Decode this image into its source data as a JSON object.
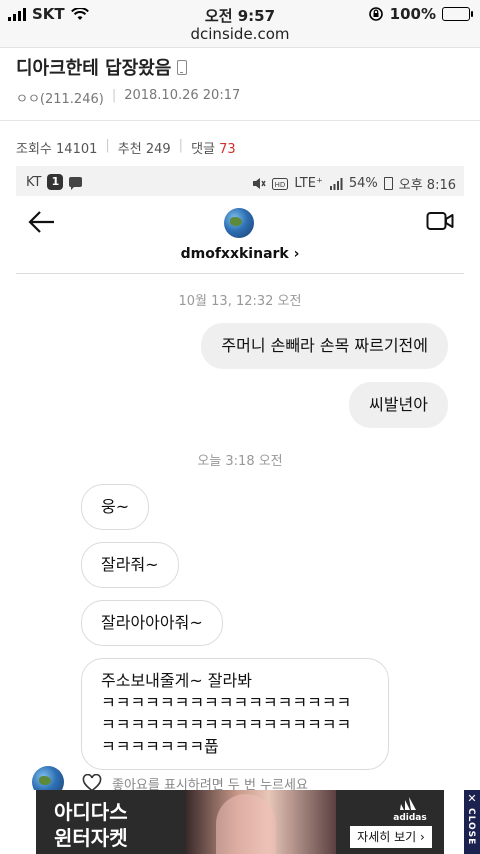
{
  "status_bar": {
    "carrier": "SKT",
    "time": "오전 9:57",
    "battery": "100%"
  },
  "browser": {
    "url": "dcinside.com"
  },
  "post": {
    "title": "디아크한테 답장왔음",
    "author": "ㅇㅇ(211.246)",
    "datetime": "2018.10.26 20:17",
    "views_label": "조회수",
    "views": "14101",
    "likes_label": "추천",
    "likes": "249",
    "comments_label": "댓글",
    "comments": "73"
  },
  "screenshot": {
    "android_status": {
      "carrier": "KT",
      "notification_count": "1",
      "network": "LTE⁺",
      "battery": "54%",
      "time": "오후 8:16"
    },
    "dm_header": {
      "username": "dmofxxkinark",
      "chevron": "›"
    },
    "messages": {
      "ts1": "10월 13, 12:32 오전",
      "out1": "주머니 손빼라 손목 짜르기전에",
      "out2": "씨발년아",
      "ts2": "오늘 3:18 오전",
      "in1": "웅~",
      "in2": "잘라줘~",
      "in3": "잘라아아아줘~",
      "in4_line1": "주소보내줄게~ 잘라봐",
      "in4_line2": "ㅋㅋㅋㅋㅋㅋㅋㅋㅋㅋㅋㅋㅋㅋㅋㅋㅋ",
      "in4_line3": "ㅋㅋㅋㅋㅋㅋㅋㅋㅋㅋㅋㅋㅋㅋㅋㅋㅋ",
      "in4_line4": "ㅋㅋㅋㅋㅋㅋㅋ풉"
    },
    "like_hint": "좋아요를 표시하려면 두 번 누르세요"
  },
  "ad": {
    "line1": "아디다스",
    "line2": "윈터자켓",
    "brand": "adidas",
    "cta": "자세히 보기 ›",
    "close_label": "CLOSE",
    "close_x": "✕"
  },
  "colors": {
    "comment_count": "#d0312d",
    "ad_close_strip": "#1c2250",
    "outgoing_bubble": "#efefef"
  }
}
